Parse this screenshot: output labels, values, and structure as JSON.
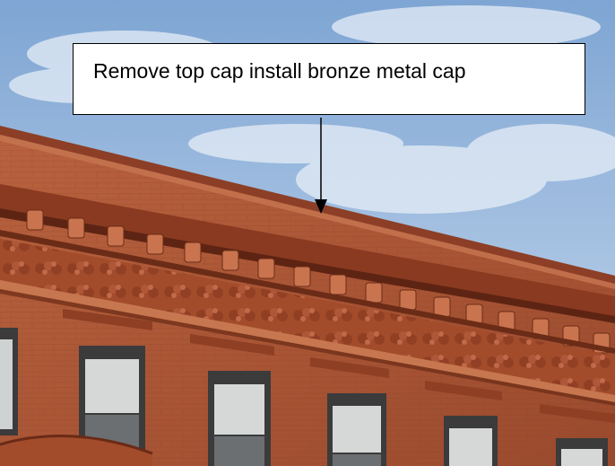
{
  "photo": {
    "callout_text": "Remove top cap install bronze metal cap"
  },
  "colors": {
    "sky": "#8fb2d9",
    "brick": "#b9623f",
    "terracotta": "#a9512f",
    "callout_border": "#000000",
    "arrow": "#000000"
  }
}
